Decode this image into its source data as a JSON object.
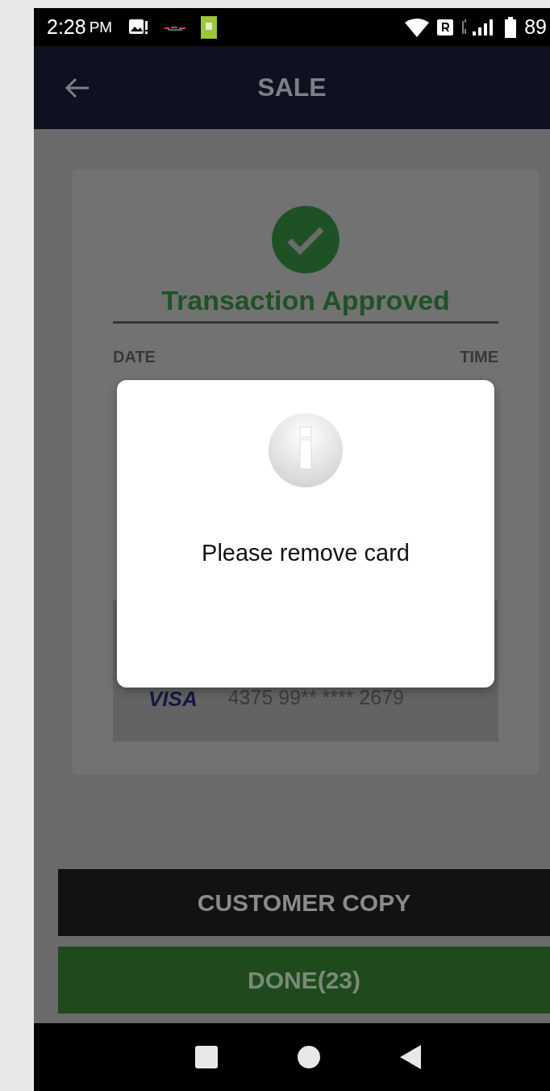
{
  "status_bar": {
    "time": "2:28",
    "meridiem": "PM",
    "battery": "89"
  },
  "app_bar": {
    "title": "SALE"
  },
  "receipt": {
    "status": "Transaction Approved",
    "date_label": "DATE",
    "time_label": "TIME",
    "card": {
      "brand": "VISA",
      "number": "4375 99** **** 2679"
    }
  },
  "dialog": {
    "message": "Please remove card"
  },
  "buttons": [
    {
      "label": "CUSTOMER COPY",
      "kind": "secondary"
    },
    {
      "label": "DONE(23)",
      "kind": "primary"
    }
  ]
}
